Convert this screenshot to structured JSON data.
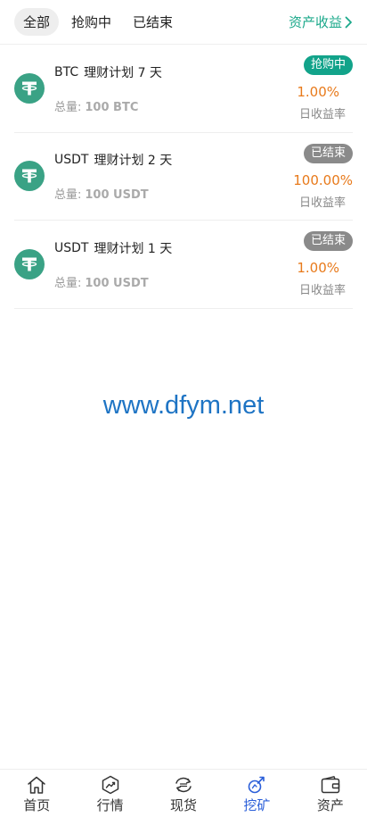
{
  "tabs": [
    {
      "label": "全部",
      "active": true
    },
    {
      "label": "抢购中",
      "active": false
    },
    {
      "label": "已结束",
      "active": false
    }
  ],
  "assets_link": "资产收益",
  "plans": [
    {
      "coin": "BTC",
      "name": "理财计划 7 天",
      "total_label": "总量:",
      "total": "100 BTC",
      "status": "抢购中",
      "rate": "1.00%",
      "rate_label": "日收益率"
    },
    {
      "coin": "USDT",
      "name": "理财计划 2 天",
      "total_label": "总量:",
      "total": "100 USDT",
      "status": "已结束",
      "rate": "100.00%",
      "rate_label": "日收益率"
    },
    {
      "coin": "USDT",
      "name": "理财计划 1 天",
      "total_label": "总量:",
      "total": "100 USDT",
      "status": "已结束",
      "rate": "1.00%",
      "rate_label": "日收益率"
    }
  ],
  "watermark": "www.dfym.net",
  "nav": [
    {
      "label": "首页",
      "icon": "home-icon"
    },
    {
      "label": "行情",
      "icon": "market-icon"
    },
    {
      "label": "现货",
      "icon": "exchange-icon"
    },
    {
      "label": "挖矿",
      "icon": "mining-icon",
      "active": true
    },
    {
      "label": "资产",
      "icon": "wallet-icon"
    }
  ],
  "colors": {
    "accent": "#12a38a",
    "rate": "#e87a1b",
    "nav_active": "#2b5fd9",
    "ended": "#8a8a8a"
  }
}
